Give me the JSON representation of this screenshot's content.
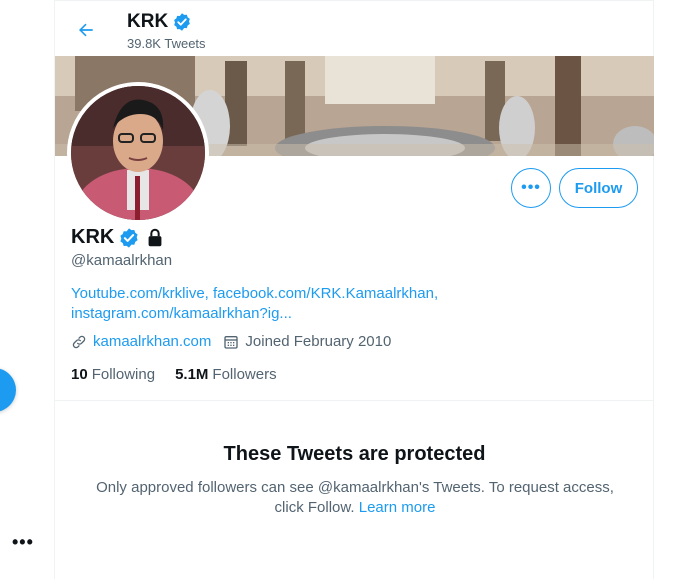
{
  "header": {
    "name": "KRK",
    "tweet_count": "39.8K Tweets"
  },
  "actions": {
    "more_label": "•••",
    "follow_label": "Follow"
  },
  "profile": {
    "display_name": "KRK",
    "handle": "@kamaalrkhan",
    "bio_links": "Youtube.com/krklive, facebook.com/KRK.Kamaalrkhan, instagram.com/kamaalrkhan?ig...",
    "website": "kamaalrkhan.com",
    "joined": "Joined February 2010",
    "following_count": "10",
    "following_label": "Following",
    "followers_count": "5.1M",
    "followers_label": "Followers"
  },
  "protected": {
    "title": "These Tweets are protected",
    "body": "Only approved followers can see @kamaalrkhan's Tweets. To request access, click Follow.",
    "learn_more": "Learn more"
  },
  "left_rail": {
    "more_dots": "•••"
  },
  "colors": {
    "accent": "#1d9bf0",
    "text_primary": "#0f1419",
    "text_secondary": "#536471",
    "border": "#eff3f4"
  },
  "icons": [
    "back-arrow-icon",
    "verified-badge-icon",
    "lock-icon",
    "link-icon",
    "calendar-icon"
  ]
}
